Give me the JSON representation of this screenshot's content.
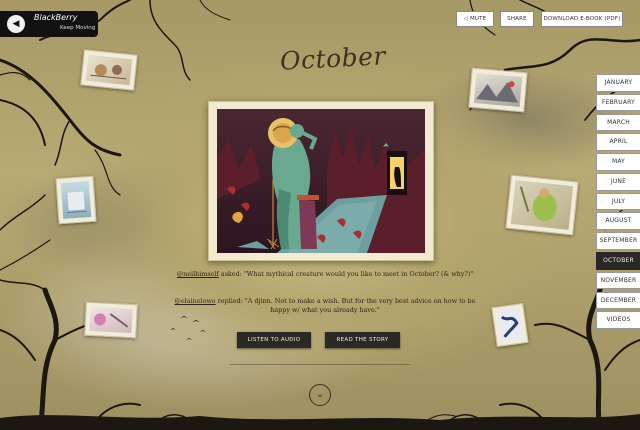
{
  "brand": {
    "name": "BlackBerry",
    "tagline": "Keep Moving",
    "back_icon": "back-arrow-icon"
  },
  "topbar": {
    "mute_label": "MUTE",
    "share_label": "SHARE",
    "download_label": "DOWNLOAD E-BOOK (PDF)"
  },
  "page": {
    "title": "October"
  },
  "story": {
    "question_handle": "@neilhimself",
    "question_text": " asked: \"What mythical creature would you like to meet in October? (& why?)\"",
    "reply_handle": "@elainelowe",
    "reply_text": " replied: \"A djinn. Not to make a wish. But for the very best advice on how to be happy w/ what you already have.\""
  },
  "actions": {
    "listen_label": "LISTEN TO AUDIO",
    "read_label": "READ THE STORY"
  },
  "months": [
    {
      "label": "JANUARY"
    },
    {
      "label": "FEBRUARY"
    },
    {
      "label": "MARCH"
    },
    {
      "label": "APRIL"
    },
    {
      "label": "MAY"
    },
    {
      "label": "JUNE"
    },
    {
      "label": "JULY"
    },
    {
      "label": "AUGUST"
    },
    {
      "label": "SEPTEMBER"
    },
    {
      "label": "OCTOBER",
      "active": true
    },
    {
      "label": "NOVEMBER"
    },
    {
      "label": "DECEMBER"
    },
    {
      "label": "VIDEOS"
    }
  ],
  "colors": {
    "accent_dark": "#2a2826",
    "background": "#b3a56d",
    "illustration_bg": "#3a1f2a",
    "creature": "#6aa890"
  }
}
